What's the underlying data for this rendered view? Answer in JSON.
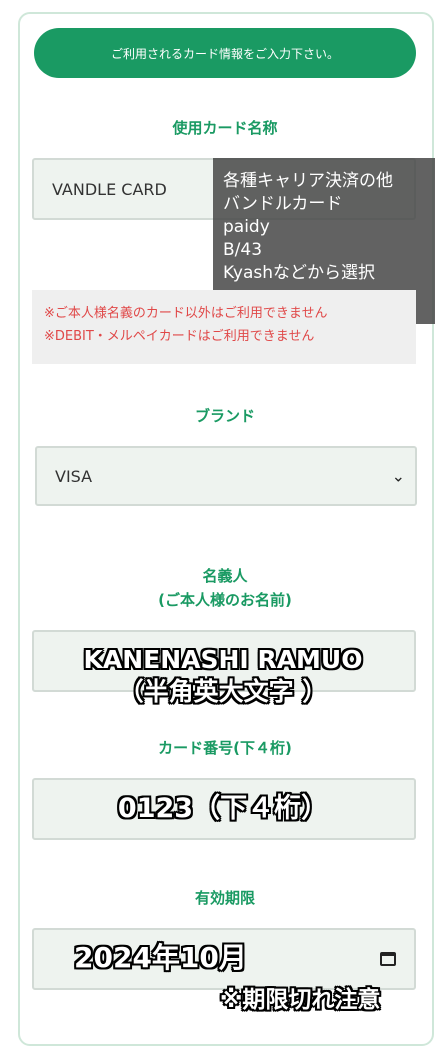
{
  "banner": "ご利用されるカード情報をご入力下さい。",
  "card_name": {
    "label": "使用カード名称",
    "value": "VANDLE CARD",
    "overlay": [
      "各種キャリア決済の他",
      "バンドルカード",
      "paidy",
      "B/43",
      "Kyashなどから選択"
    ]
  },
  "warning": {
    "line1": "※ご本人様名義のカード以外はご利用できません",
    "line2": "※DEBIT・メルペイカードはご利用できません"
  },
  "brand": {
    "label": "ブランド",
    "selected": "VISA"
  },
  "holder": {
    "label_line1": "名義人",
    "label_line2": "(ご本人様のお名前)",
    "overlay_line1": "KANENASHI RAMUO",
    "overlay_line2": "（半角英大文字 ）"
  },
  "card_number": {
    "label": "カード番号(下４桁)",
    "overlay": "0123（下４桁）"
  },
  "expiry": {
    "label": "有効期限",
    "overlay": "2024年10月",
    "note": "※期限切れ注意"
  },
  "colors": {
    "accent": "#1a9a63",
    "field_bg": "#eef3ef",
    "warning_text": "#e04848"
  },
  "icons": {
    "select": "chevron-down-icon",
    "date": "calendar-icon"
  }
}
